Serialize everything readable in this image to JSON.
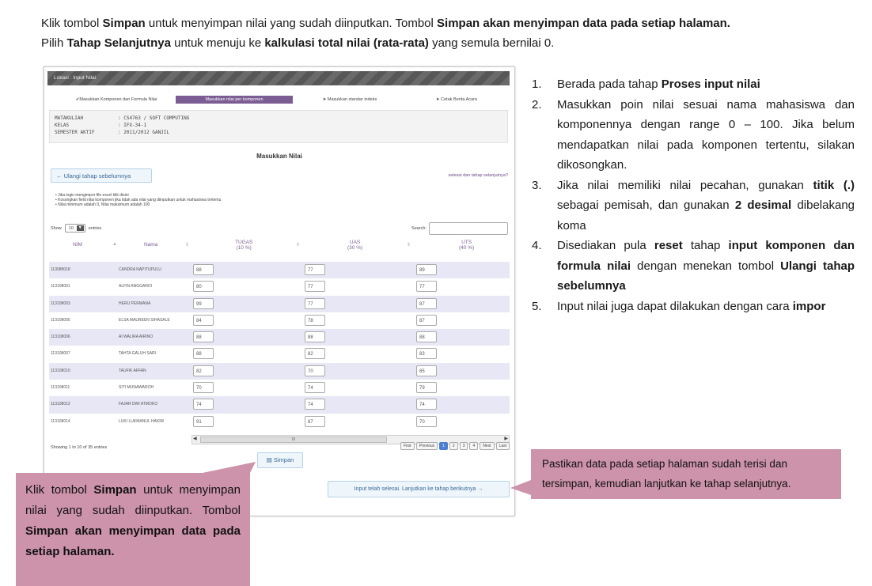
{
  "intro": {
    "l1a": "Klik tombol ",
    "l1b": "Simpan",
    "l1c": " untuk menyimpan nilai yang sudah diinputkan. Tombol ",
    "l1d": "Simpan akan menyimpan data pada setiap halaman.",
    "l2a": "Pilih ",
    "l2b": "Tahap Selanjutnya",
    "l2c": " untuk menuju ke ",
    "l2d": "kalkulasi total nilai (rata-rata)",
    "l2e": " yang semula bernilai 0."
  },
  "shot": {
    "location": "Lokasi : Input Nilai",
    "steps": [
      "✔Masukkan Komponen dan Formula Nilai",
      "Masukkan nilai per komponen",
      "➤ Masukkan standar indeks",
      "➤ Cetak Berita Acara"
    ],
    "info": [
      {
        "k": "MATAKULIAH",
        "v": ": CS4763 / SOFT COMPUTING"
      },
      {
        "k": "KELAS",
        "v": ": IFX-34-1"
      },
      {
        "k": "SEMESTER AKTIF",
        "v": ": 2011/2012 GANJIL"
      }
    ],
    "section_title": "Masukkan Nilai",
    "prev_button": "← Ulangi tahap sebelumnya",
    "next_link": "selesai dan tahap selanjutnya?",
    "notes": [
      "Jika ingin mengimpor file excel klik disini",
      "Kosongkan field nilai komponen jika tidak ada nilai yang diinputkan untuk mahasiswa tertentu",
      "Nilai minimum adalah 0, Nilai maksimum adalah 100"
    ],
    "show_label": "Show",
    "show_value": "10",
    "entries_label": "entries",
    "search_label": "Search:",
    "headers": {
      "nim": "NIM",
      "nama": "Nama",
      "tugas": "TUGAS",
      "tugas_w": "(10 %)",
      "uas": "UAS",
      "uas_w": "(30 %)",
      "uts": "UTS",
      "uts_w": "(40 %)"
    },
    "rows": [
      {
        "nim": "113088018",
        "nama": "CANDRA NAPITUPULU",
        "tugas": "88",
        "uas": "77",
        "uts": "89"
      },
      {
        "nim": "113108001",
        "nama": "ALFIN ANGGARIO",
        "tugas": "80",
        "uas": "77",
        "uts": "77"
      },
      {
        "nim": "113108003",
        "nama": "HERU PERMANA",
        "tugas": "99",
        "uas": "77",
        "uts": "87"
      },
      {
        "nim": "113108005",
        "nama": "ELSA MAUREEN SIHASALE",
        "tugas": "84",
        "uas": "78",
        "uts": "87"
      },
      {
        "nim": "113108006",
        "nama": "AI WALIRA AIRINO",
        "tugas": "88",
        "uas": "88",
        "uts": "88"
      },
      {
        "nim": "113108007",
        "nama": "TAHTA GALUH SARI",
        "tugas": "88",
        "uas": "82",
        "uts": "83"
      },
      {
        "nim": "113108010",
        "nama": "TAUFIK AFFAN",
        "tugas": "82",
        "uas": "70",
        "uts": "85"
      },
      {
        "nim": "113108011",
        "nama": "SITI MUNAWAROH",
        "tugas": "70",
        "uas": "74",
        "uts": "79"
      },
      {
        "nim": "113108012",
        "nama": "FAJAR DWI ATMOKO",
        "tugas": "74",
        "uas": "74",
        "uts": "74"
      },
      {
        "nim": "113108014",
        "nama": "LUKI LUKMANUL HAKIM",
        "tugas": "91",
        "uas": "87",
        "uts": "70"
      }
    ],
    "showing": "Showing 1 to 10 of 35 entries",
    "pager": [
      "First",
      "Previous",
      "1",
      "2",
      "3",
      "4",
      "Next",
      "Last"
    ],
    "scroll_thumb": "III",
    "save_button": "▤ Simpan",
    "continue_button": "Input telah selesai. Lanjutkan ke tahap berikutnya →"
  },
  "callout1": {
    "a": "Klik tombol ",
    "b": "Simpan",
    "c": " untuk menyimpan nilai yang sudah diinputkan. Tombol ",
    "d": "Simpan akan menyimpan data pada setiap halaman."
  },
  "callout2": "Pastikan data pada setiap halaman sudah terisi dan tersimpan, kemudian lanjutkan ke tahap selanjutnya.",
  "list": [
    {
      "n": "1.",
      "parts": [
        [
          "Berada pada tahap ",
          false
        ],
        [
          "Proses input nilai",
          true
        ]
      ]
    },
    {
      "n": "2.",
      "parts": [
        [
          "Masukkan poin nilai sesuai nama mahasiswa dan komponennya dengan range 0 – 100. Jika belum mendapatkan nilai pada komponen tertentu, silakan dikosongkan.",
          false
        ]
      ]
    },
    {
      "n": "3.",
      "parts": [
        [
          "Jika nilai memiliki nilai pecahan, gunakan ",
          false
        ],
        [
          "titik (.)",
          true
        ],
        [
          " sebagai pemisah, dan gunakan ",
          false
        ],
        [
          "2 desimal",
          true
        ],
        [
          " dibelakang koma",
          false
        ]
      ]
    },
    {
      "n": "4.",
      "parts": [
        [
          "Disediakan pula ",
          false
        ],
        [
          "reset",
          true
        ],
        [
          " tahap ",
          false
        ],
        [
          "input komponen dan formula nilai",
          true
        ],
        [
          " dengan menekan tombol ",
          false
        ],
        [
          "Ulangi tahap sebelumnya",
          true
        ]
      ]
    },
    {
      "n": "5.",
      "parts": [
        [
          "Input nilai juga dapat dilakukan dengan cara ",
          false
        ],
        [
          "impor",
          true
        ]
      ]
    }
  ]
}
